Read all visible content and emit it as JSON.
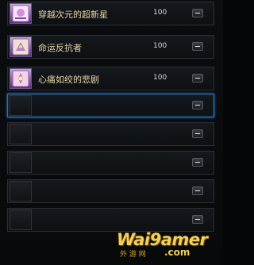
{
  "items": [
    {
      "name": "穿越次元的超新星",
      "amount": "100",
      "filled": true,
      "selected": false
    },
    {
      "name": "命运反抗者",
      "amount": "100",
      "filled": true,
      "selected": false
    },
    {
      "name": "心痛如绞的悲剧",
      "amount": "100",
      "filled": true,
      "selected": false
    },
    {
      "name": "",
      "amount": "",
      "filled": false,
      "selected": true
    },
    {
      "name": "",
      "amount": "",
      "filled": false,
      "selected": false
    },
    {
      "name": "",
      "amount": "",
      "filled": false,
      "selected": false
    },
    {
      "name": "",
      "amount": "",
      "filled": false,
      "selected": false
    },
    {
      "name": "",
      "amount": "",
      "filled": false,
      "selected": false
    }
  ],
  "watermark": {
    "main": "Wai9amer",
    "sub": "外 游 网",
    "domain": ".com"
  }
}
